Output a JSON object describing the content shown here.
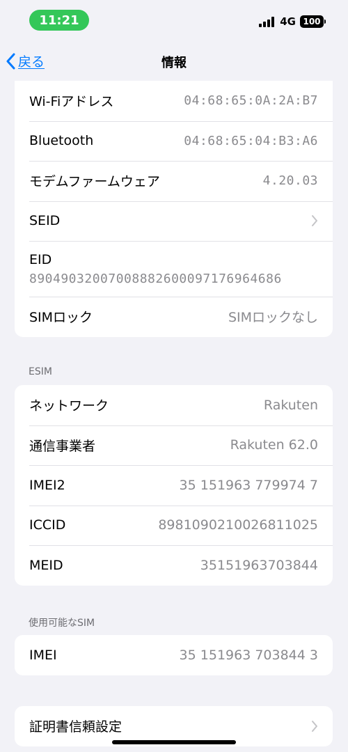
{
  "status_bar": {
    "time": "11:21",
    "network": "4G",
    "battery": "100",
    "time_pill_color": "#34c759",
    "icons": [
      "signal-icon",
      "battery-icon"
    ]
  },
  "nav": {
    "back_label": "戻る",
    "title": "情報",
    "back_icon": "chevron-left-icon",
    "accent_color": "#007aff"
  },
  "group_device": {
    "wifi": {
      "label": "Wi-Fiアドレス",
      "value": "04:68:65:0A:2A:B7"
    },
    "bluetooth": {
      "label": "Bluetooth",
      "value": "04:68:65:04:B3:A6"
    },
    "modem": {
      "label": "モデムファームウェア",
      "value": "4.20.03"
    },
    "seid": {
      "label": "SEID"
    },
    "eid": {
      "label": "EID",
      "value": "89049032007008882600097176964686"
    },
    "simlock": {
      "label": "SIMロック",
      "value": "SIMロックなし"
    }
  },
  "esim": {
    "header": "ESIM",
    "network": {
      "label": "ネットワーク",
      "value": "Rakuten"
    },
    "carrier": {
      "label": "通信事業者",
      "value": "Rakuten 62.0"
    },
    "imei2": {
      "label": "IMEI2",
      "value": "35 151963 779974 7"
    },
    "iccid": {
      "label": "ICCID",
      "value": "8981090210026811025"
    },
    "meid": {
      "label": "MEID",
      "value": "35151963703844"
    }
  },
  "available_sim": {
    "header": "使用可能なSIM",
    "imei": {
      "label": "IMEI",
      "value": "35 151963 703844 3"
    }
  },
  "trust": {
    "label": "証明書信頼設定",
    "icon": "chevron-right-icon"
  }
}
